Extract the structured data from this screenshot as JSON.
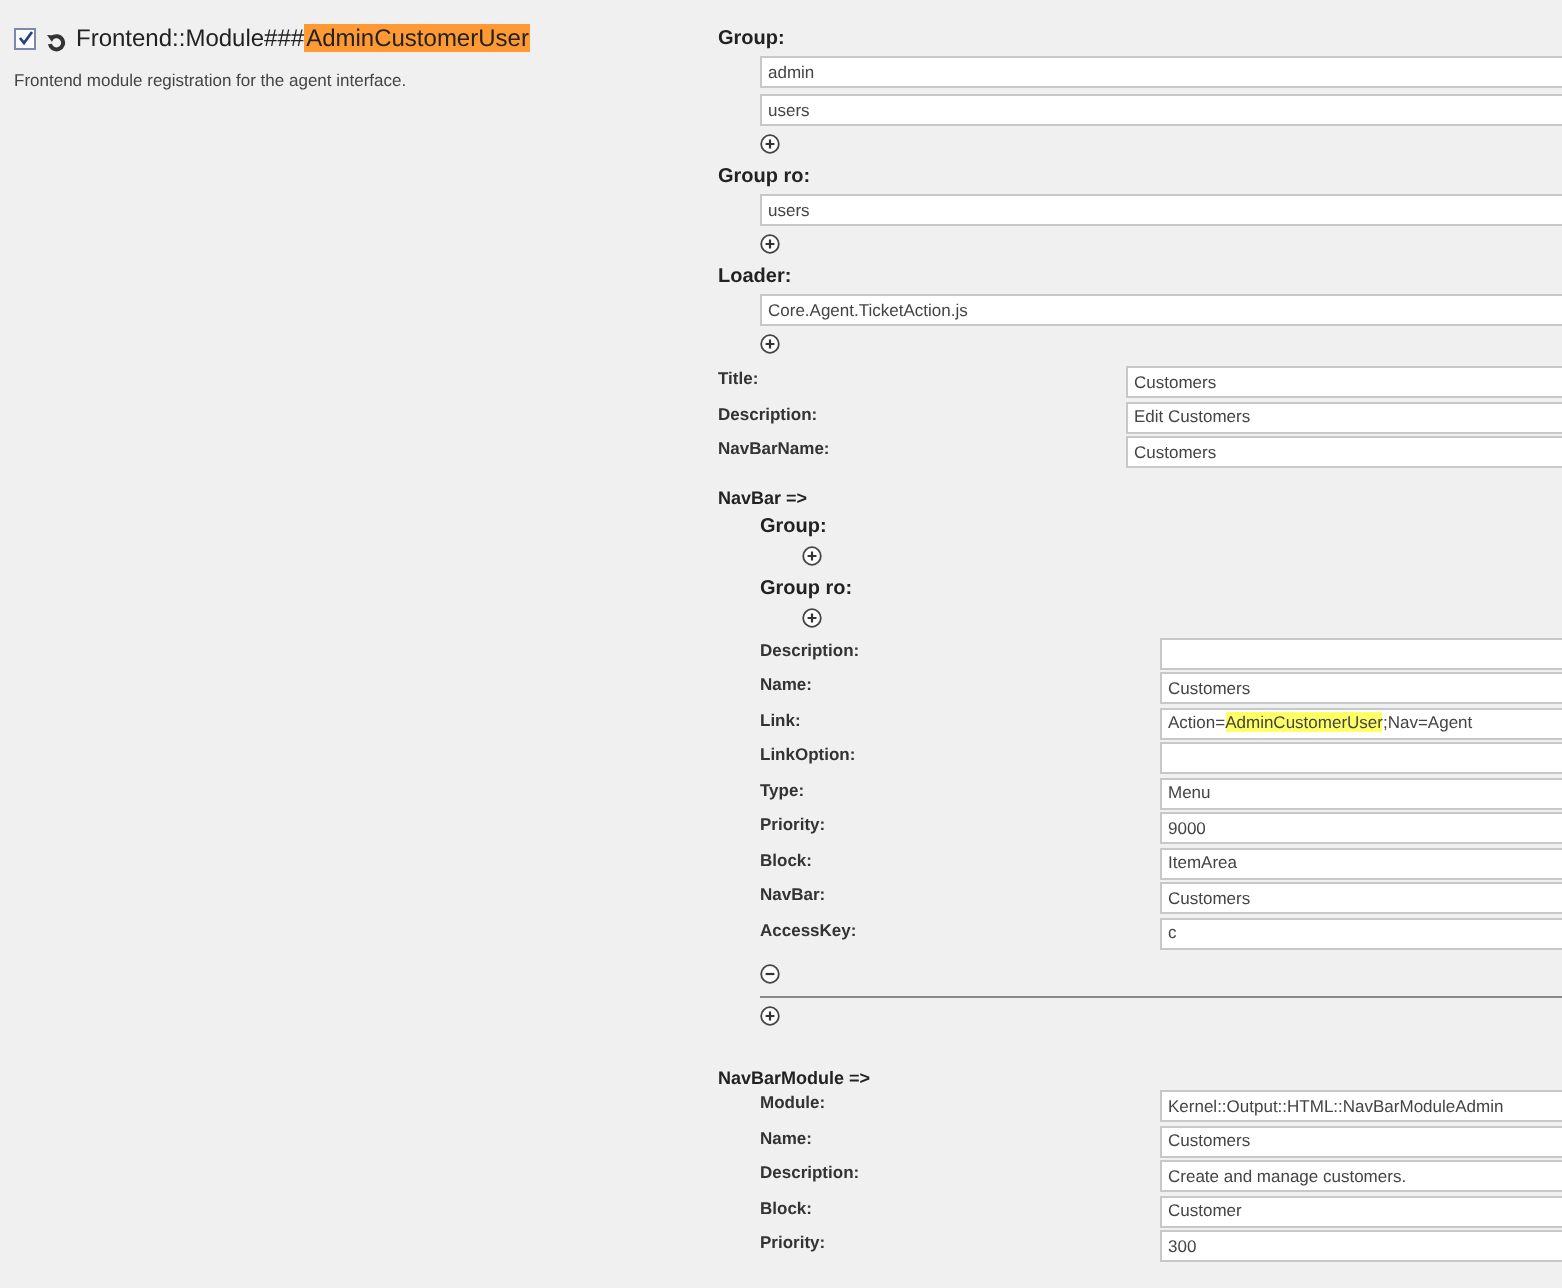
{
  "setting": {
    "checked": true,
    "name_parts": [
      {
        "text": "Frontend::Module###",
        "highlighted": false
      },
      {
        "text": "AdminCustomerUser",
        "highlighted": true
      }
    ],
    "description": "Frontend module registration for the agent interface."
  },
  "lists": [
    {
      "label": "Group:",
      "items": [
        "admin",
        "users"
      ]
    },
    {
      "label": "Group ro:",
      "items": [
        "users"
      ]
    },
    {
      "label": "Loader:",
      "items": [
        "Core.Agent.TicketAction.js"
      ]
    }
  ],
  "fields": [
    {
      "label": "Title:",
      "value": [
        {
          "text": "Customers",
          "highlighted": false
        }
      ]
    },
    {
      "label": "Description:",
      "value": [
        {
          "text": "Edit Customers",
          "highlighted": false
        }
      ]
    },
    {
      "label": "NavBarName:",
      "value": [
        {
          "text": "Customers",
          "highlighted": false
        }
      ]
    }
  ],
  "navbar": {
    "label": "NavBar =>",
    "lists": [
      {
        "label": "Group:"
      },
      {
        "label": "Group ro:"
      }
    ],
    "fields": [
      {
        "label": "Description:"
      },
      {
        "label": "Name:",
        "value": [
          {
            "text": "Customers",
            "highlighted": false
          }
        ]
      },
      {
        "label": "Link:",
        "value": [
          {
            "text": "Action=",
            "highlighted": false
          },
          {
            "text": "AdminCustomerUser",
            "highlighted": true
          },
          {
            "text": ";Nav=Agent",
            "highlighted": false
          }
        ]
      },
      {
        "label": "LinkOption:"
      },
      {
        "label": "Type:",
        "value": [
          {
            "text": "Menu",
            "highlighted": false
          }
        ]
      },
      {
        "label": "Priority:",
        "value": [
          {
            "text": "9000",
            "highlighted": false
          }
        ]
      },
      {
        "label": "Block:",
        "value": [
          {
            "text": "ItemArea",
            "highlighted": false
          }
        ]
      },
      {
        "label": "NavBar:",
        "value": [
          {
            "text": "Customers",
            "highlighted": false
          }
        ]
      },
      {
        "label": "AccessKey:",
        "value": [
          {
            "text": "c",
            "highlighted": false
          }
        ]
      }
    ]
  },
  "navbar_module": {
    "label": "NavBarModule =>",
    "fields": [
      {
        "label": "Module:",
        "value": [
          {
            "text": "Kernel::Output::HTML::NavBarModuleAdmin",
            "highlighted": false
          }
        ]
      },
      {
        "label": "Name:",
        "value": [
          {
            "text": "Customers",
            "highlighted": false
          }
        ]
      },
      {
        "label": "Description:",
        "value": [
          {
            "text": "Create and manage customers.",
            "highlighted": false
          }
        ]
      },
      {
        "label": "Block:",
        "value": [
          {
            "text": "Customer",
            "highlighted": false
          }
        ]
      },
      {
        "label": "Priority:",
        "value": [
          {
            "text": "300",
            "highlighted": false
          }
        ]
      }
    ]
  }
}
